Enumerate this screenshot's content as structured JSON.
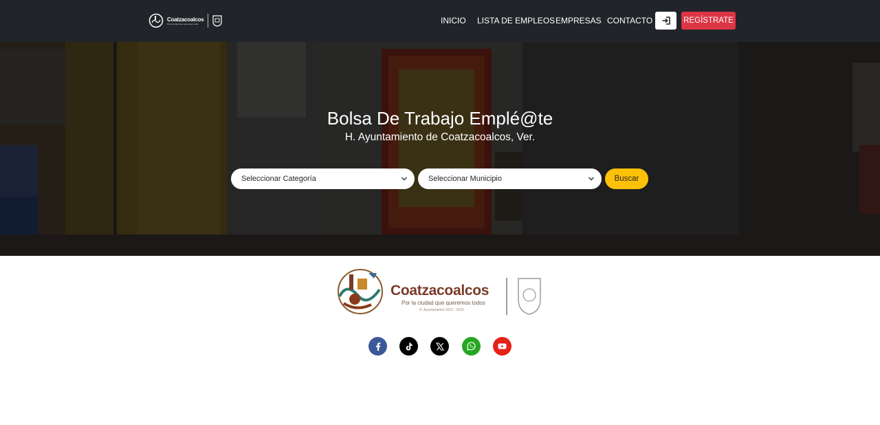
{
  "navbar": {
    "brand_name": "Coatzacoalcos",
    "brand_tagline": "Por la ciudad que queremos todos",
    "links": [
      {
        "label": "INICIO"
      },
      {
        "label": "LISTA DE EMPLEOS"
      },
      {
        "label": "EMPRESAS"
      },
      {
        "label": "CONTACTO"
      }
    ],
    "login_icon": "sign-in-icon",
    "register_label": "REGÍSTRATE"
  },
  "hero": {
    "title": "Bolsa De Trabajo Emplé@te",
    "subtitle": "H. Ayuntamiento de Coatzacoalcos, Ver.",
    "category_select": {
      "selected": "Seleccionar Categoría"
    },
    "municipality_select": {
      "selected": "Seleccionar Municipio"
    },
    "search_label": "Buscar"
  },
  "footer": {
    "brand_name": "Coatzacoalcos",
    "brand_tagline": "Por la ciudad que queremos todos",
    "brand_period": "H. Ayuntamiento 2022 - 2025",
    "social": [
      {
        "icon": "facebook-icon",
        "color": "#3b5998"
      },
      {
        "icon": "tiktok-icon",
        "color": "#000000"
      },
      {
        "icon": "x-icon",
        "color": "#000000"
      },
      {
        "icon": "whatsapp-icon",
        "color": "#25a71f"
      },
      {
        "icon": "youtube-icon",
        "color": "#e62117"
      }
    ]
  },
  "colors": {
    "navbar_bg": "#212429",
    "register": "#dc3545",
    "search": "#ffc107",
    "brand": "#7a3a28"
  }
}
